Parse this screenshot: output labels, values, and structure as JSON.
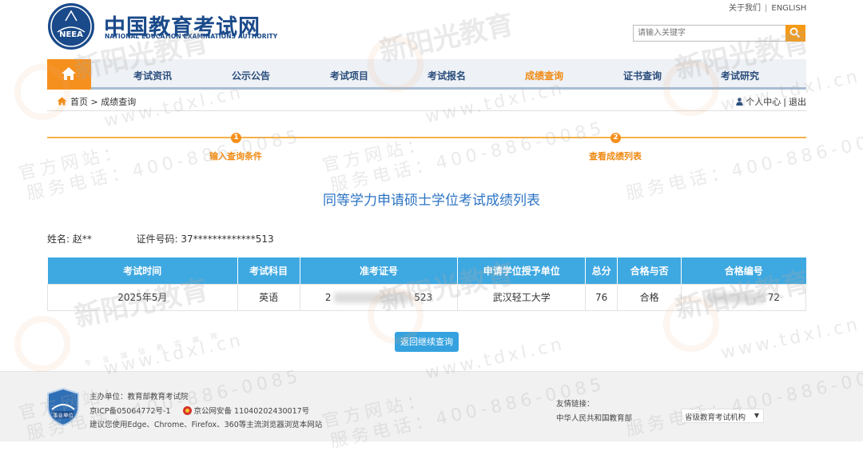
{
  "header": {
    "site_title": "中国教育考试网",
    "site_subtitle": "NATIONAL EDUCATION EXAMINATIONS AUTHORITY",
    "logo_text": "NEEA",
    "top_links": [
      "关于我们",
      "ENGLISH"
    ],
    "search_placeholder": "请输入关键字"
  },
  "nav": {
    "items": [
      "考试资讯",
      "公示公告",
      "考试项目",
      "考试报名",
      "成绩查询",
      "证书查询",
      "考试研究"
    ],
    "active": "成绩查询"
  },
  "breadcrumb": {
    "home": "首页",
    "separator": ">",
    "current": "成绩查询",
    "user_center": "个人中心",
    "logout": "退出"
  },
  "steps": [
    {
      "num": "1",
      "label": "输入查询条件"
    },
    {
      "num": "2",
      "label": "查看成绩列表"
    }
  ],
  "page_heading": "同等学力申请硕士学位考试成绩列表",
  "candidate": {
    "name_label": "姓名:",
    "name_value": "赵**",
    "id_label": "证件号码:",
    "id_value": "37*************513"
  },
  "table": {
    "headers": [
      "考试时间",
      "考试科目",
      "准考证号",
      "申请学位授予单位",
      "总分",
      "合格与否",
      "合格编号"
    ],
    "rows": [
      {
        "exam_time": "2025年5月",
        "subject": "英语",
        "ticket_prefix": "2",
        "ticket_suffix": "523",
        "unit": "武汉轻工大学",
        "score": "76",
        "pass": "合格",
        "cert_prefix": "",
        "cert_suffix": "72"
      }
    ]
  },
  "return_button": "返回继续查询",
  "footer": {
    "sponsor": "主办单位：教育部教育考试院",
    "icp": "京ICP备05064772号-1",
    "police": "京公网安备 11040202430017号",
    "browser_tip": "建议您使用Edge、Chrome、Firefox、360等主流浏览器浏览本网站",
    "shield_text": "事业单位",
    "friend_title": "友情链接：",
    "friend_link": "中华人民共和国教育部",
    "org_select": "省级教育考试机构"
  },
  "watermark": {
    "brand": "新阳光教育",
    "sub": [
      "专业",
      "诚信",
      "务实",
      "高效"
    ],
    "url": "www.tdxl.cn",
    "phone_label": "官方网站：",
    "phone_line": "服务电话：400-886-0085"
  },
  "colors": {
    "brand_blue": "#1a4a8a",
    "accent_orange": "#f5901e",
    "table_header": "#3ea8e1",
    "heading_blue": "#2d74c4"
  }
}
